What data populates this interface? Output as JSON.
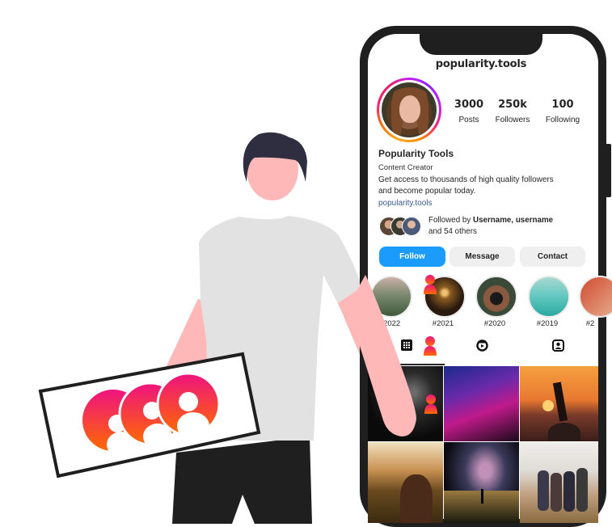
{
  "profile": {
    "username": "popularity.tools",
    "display_name": "Popularity Tools",
    "category": "Content Creator",
    "bio_line1": "Get access to thousands of high quality followers",
    "bio_line2": "and become popular today.",
    "website": "popularity.tools",
    "avatar_icon": "profile-photo"
  },
  "stats": [
    {
      "value": "3000",
      "label": "Posts"
    },
    {
      "value": "250k",
      "label": "Followers"
    },
    {
      "value": "100",
      "label": "Following"
    }
  ],
  "followed_by": {
    "prefix": "Followed by ",
    "names": "Username, username",
    "suffix": "and 54 others"
  },
  "buttons": {
    "follow": "Follow",
    "message": "Message",
    "contact": "Contact"
  },
  "highlights": [
    {
      "label": "#2022"
    },
    {
      "label": "#2021"
    },
    {
      "label": "#2020"
    },
    {
      "label": "#2019"
    },
    {
      "label": "#2"
    }
  ],
  "tabs": [
    {
      "icon": "grid-icon"
    },
    {
      "icon": "reels-icon"
    },
    {
      "icon": "tagged-icon"
    }
  ],
  "colors": {
    "follow_blue": "#1b9cfc",
    "secondary_button": "#efefef",
    "link_blue": "#3b5b8e",
    "text": "#262626",
    "badge_gradient_top": "#ee1380",
    "badge_gradient_bottom": "#ff6a00",
    "skin": "#ffb8b8",
    "shirt": "#e2e2e2",
    "hair": "#2f2e41",
    "pants": "#1f1f1f"
  }
}
